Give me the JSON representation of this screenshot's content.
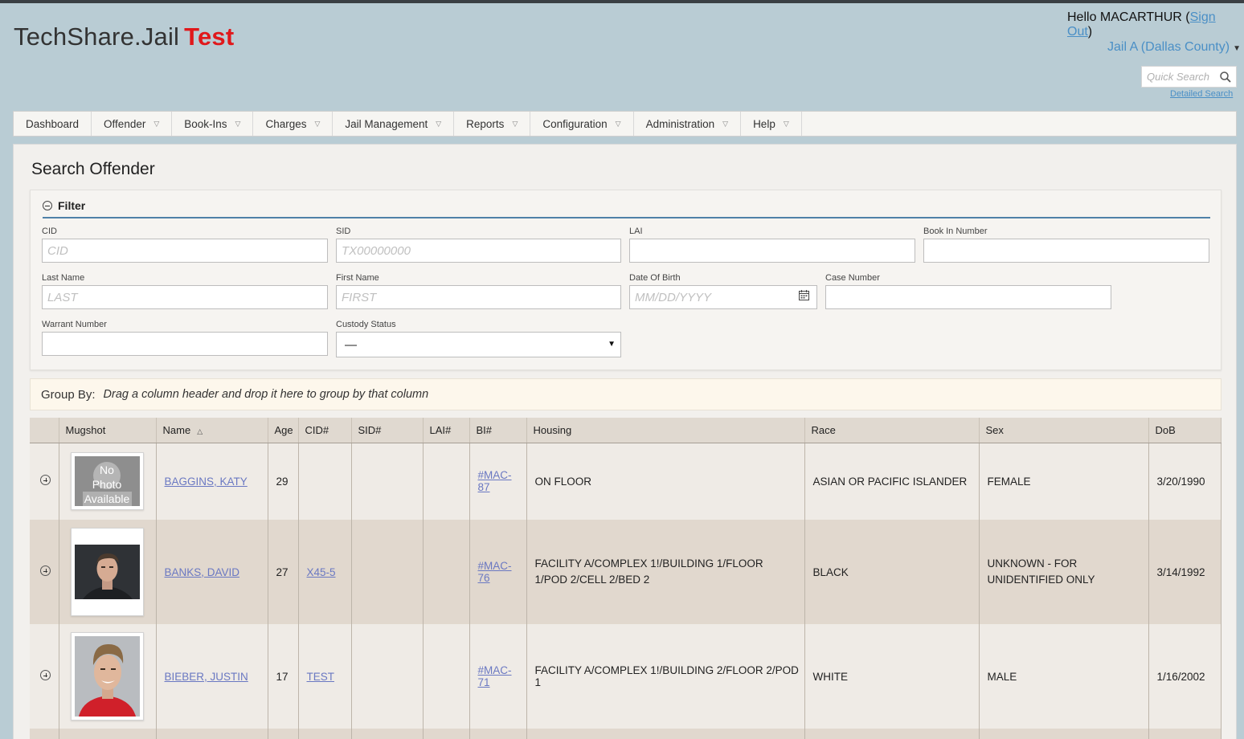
{
  "app": {
    "brand_name": "TechShare.Jail",
    "brand_env": "Test",
    "env_color": "#e0181b"
  },
  "user": {
    "greeting": "Hello MACARTHUR (",
    "sign_out": "Sign Out",
    "close_paren": ")",
    "jail": "Jail A (Dallas County)"
  },
  "search": {
    "placeholder": "Quick Search",
    "detailed": "Detailed Search"
  },
  "menu": [
    {
      "label": "Dashboard"
    },
    {
      "label": "Offender"
    },
    {
      "label": "Book-Ins"
    },
    {
      "label": "Charges"
    },
    {
      "label": "Jail Management"
    },
    {
      "label": "Reports"
    },
    {
      "label": "Configuration"
    },
    {
      "label": "Administration"
    },
    {
      "label": "Help"
    }
  ],
  "page": {
    "title": "Search Offender"
  },
  "filter": {
    "title": "Filter",
    "fields": {
      "cid": {
        "label": "CID",
        "placeholder": "CID"
      },
      "sid": {
        "label": "SID",
        "placeholder": "TX00000000"
      },
      "lai": {
        "label": "LAI",
        "placeholder": ""
      },
      "book_in": {
        "label": "Book In Number",
        "placeholder": ""
      },
      "last_name": {
        "label": "Last Name",
        "placeholder": "LAST"
      },
      "first_name": {
        "label": "First Name",
        "placeholder": "FIRST"
      },
      "dob": {
        "label": "Date Of Birth",
        "placeholder": "MM/DD/YYYY"
      },
      "case_number": {
        "label": "Case Number",
        "placeholder": ""
      },
      "warrant": {
        "label": "Warrant Number",
        "placeholder": ""
      },
      "custody": {
        "label": "Custody Status",
        "value": "—"
      }
    }
  },
  "groupby": {
    "label": "Group By:",
    "hint": "Drag a column header and drop it here to group by that column"
  },
  "grid": {
    "columns": [
      "",
      "Mugshot",
      "Name",
      "Age",
      "CID#",
      "SID#",
      "LAI#",
      "BI#",
      "Housing",
      "Race",
      "Sex",
      "DoB"
    ],
    "rows": [
      {
        "photo": "none",
        "no_photo_text": [
          "No",
          "Photo",
          "Available"
        ],
        "name": "BAGGINS, KATY",
        "age": "29",
        "cid": "",
        "sid": "",
        "lai": "",
        "bi_line1": "#MAC-",
        "bi_line2": "87",
        "housing": "ON FLOOR",
        "race": "ASIAN OR PACIFIC ISLANDER",
        "sex": "FEMALE",
        "dob": "3/20/1990"
      },
      {
        "photo": "male-dark-background",
        "name": "BANKS, DAVID",
        "age": "27",
        "cid": "X45-5",
        "sid": "",
        "lai": "",
        "bi_line1": "#MAC-",
        "bi_line2": "76",
        "housing": "FACILITY A/COMPLEX 1!/BUILDING 1/FLOOR 1/POD 2/CELL 2/BED 2",
        "race": "BLACK",
        "sex": "UNKNOWN - FOR UNIDENTIFIED ONLY",
        "dob": "3/14/1992"
      },
      {
        "photo": "male-red-shirt",
        "name": "BIEBER, JUSTIN",
        "age": "17",
        "cid": "TEST",
        "sid": "",
        "lai": "",
        "bi_line1": "#MAC-",
        "bi_line2": "71",
        "housing": "FACILITY A/COMPLEX 1!/BUILDING 2/FLOOR 2/POD 1",
        "race": "WHITE",
        "sex": "MALE",
        "dob": "1/16/2002"
      }
    ]
  }
}
